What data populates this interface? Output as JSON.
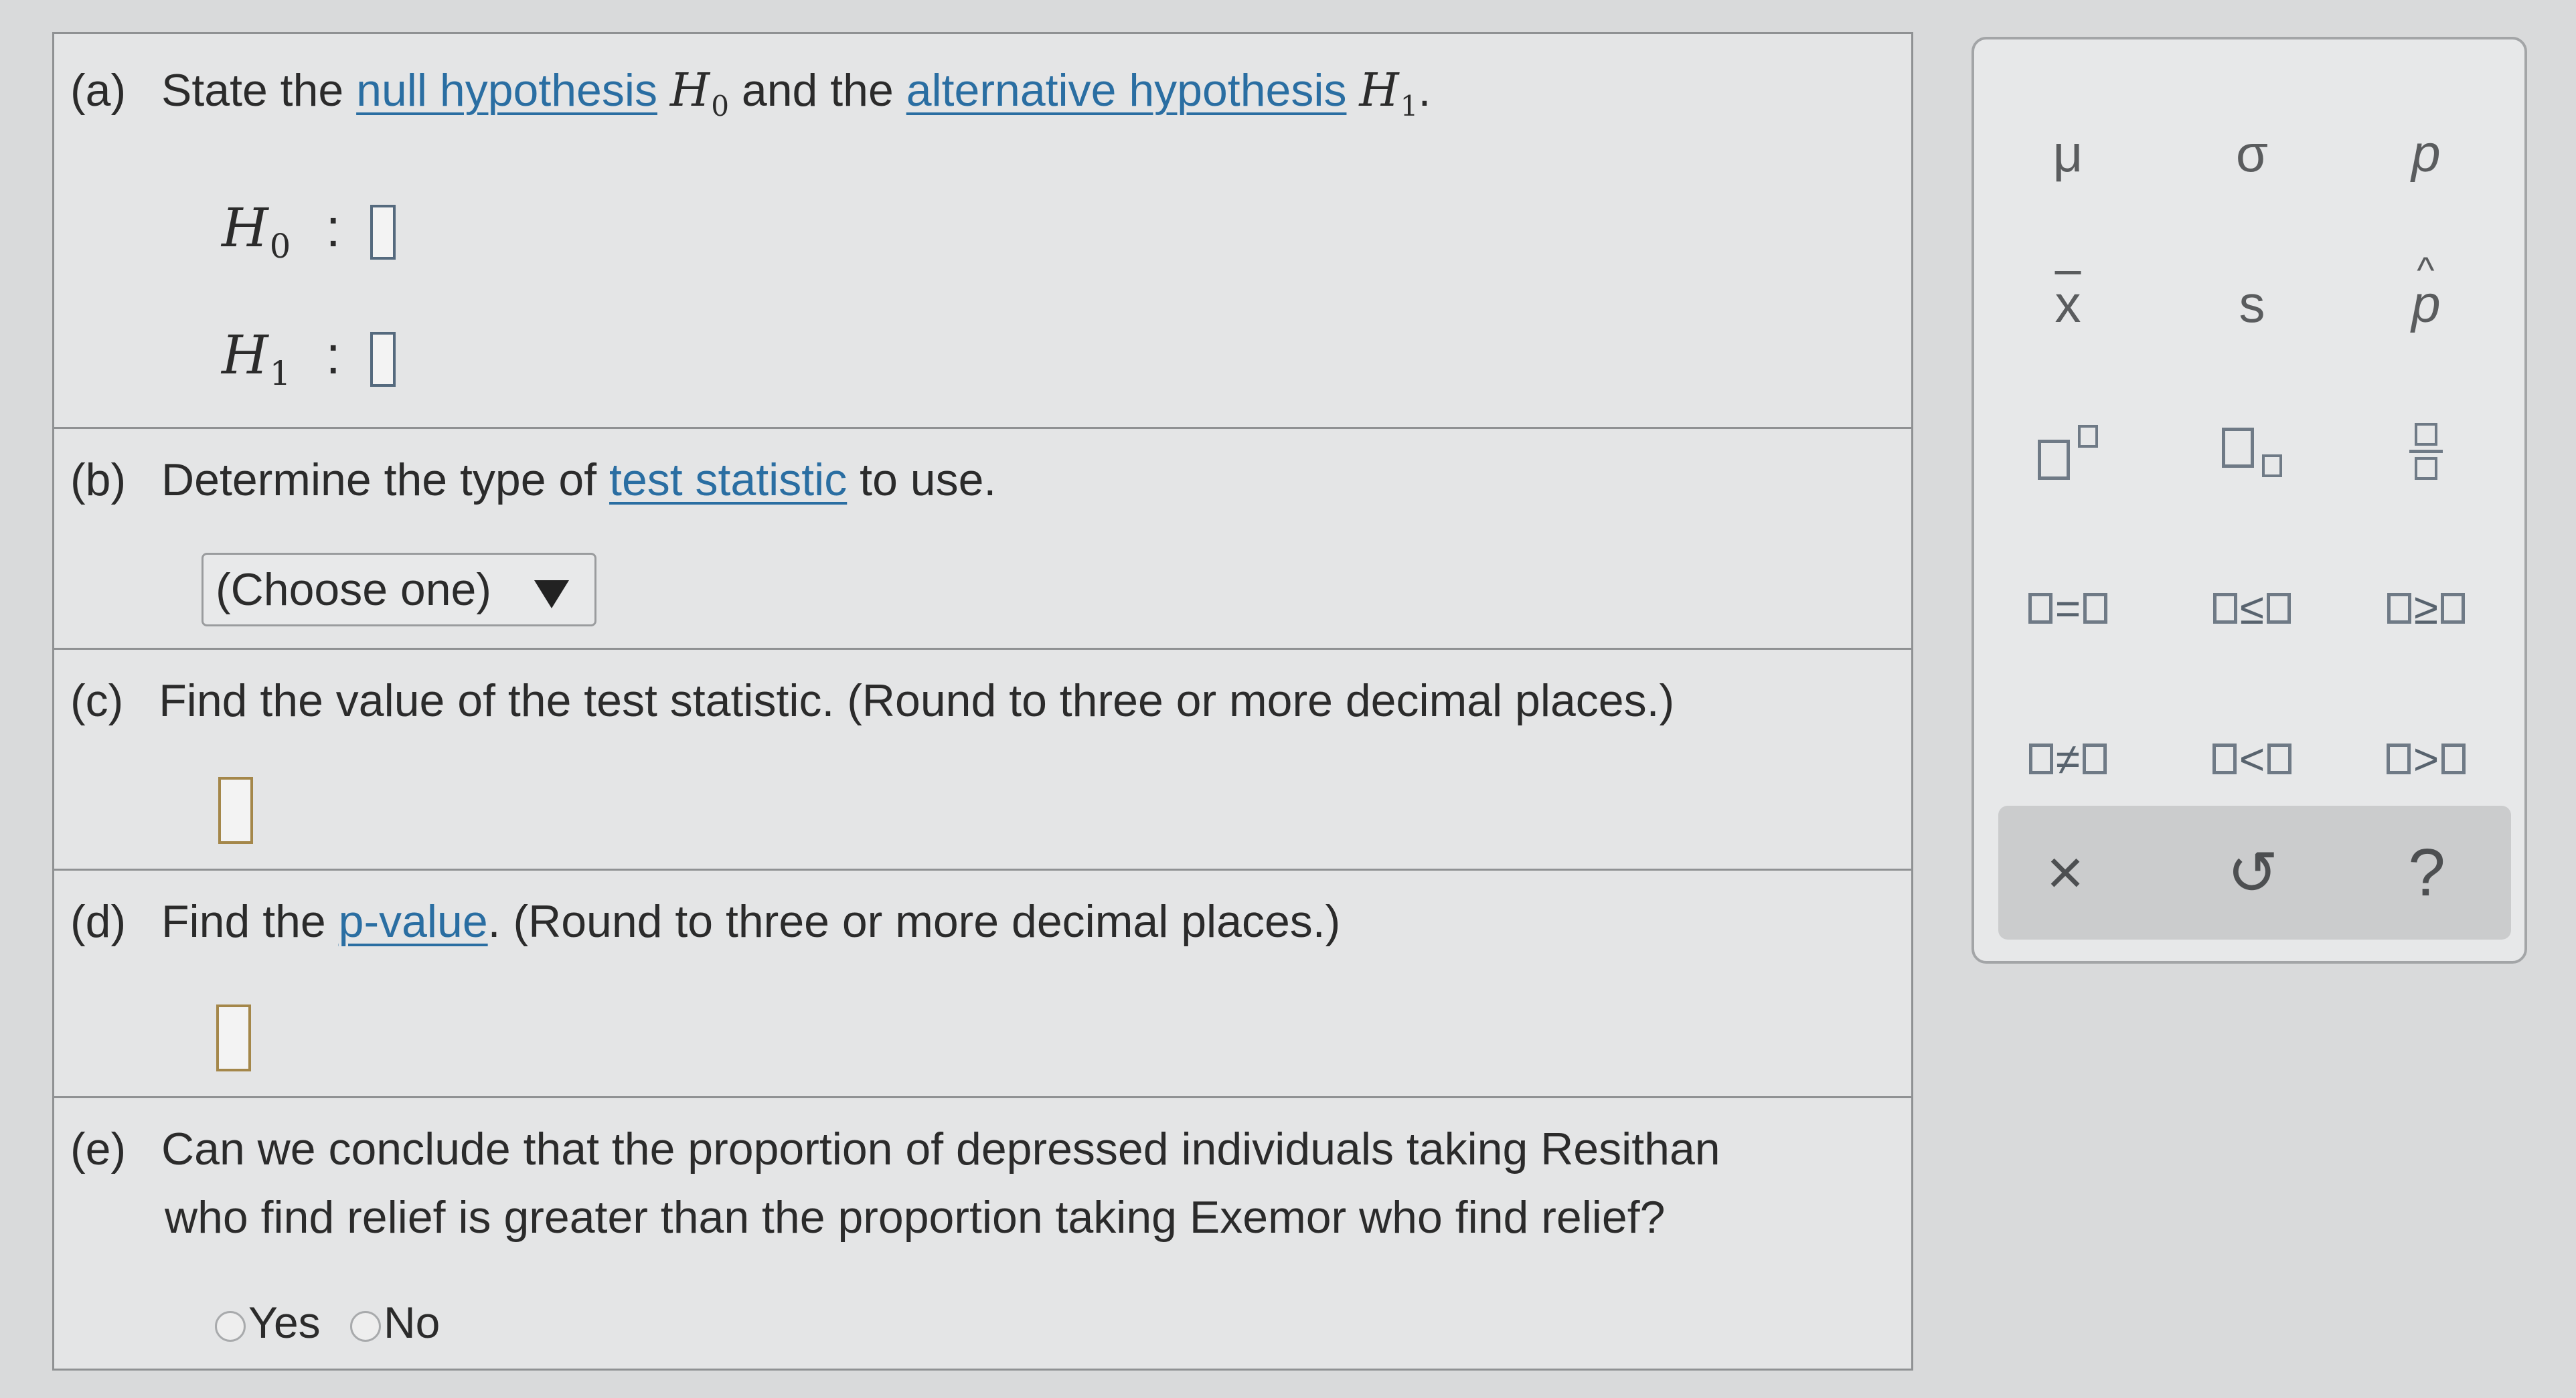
{
  "question_a": {
    "label": "(a)",
    "text_1": "State the",
    "null_link": "null hypothesis",
    "h0": "H",
    "h0_sub": "0",
    "text_2": "and the",
    "alt_link": "alternative hypothesis",
    "h1": "H",
    "h1_sub": "1",
    "period": ".",
    "row_h0_symbol": "H",
    "row_h0_sub": "0",
    "row_h1_symbol": "H",
    "row_h1_sub": "1",
    "colon": ":"
  },
  "question_b": {
    "label": "(b)",
    "text_1": "Determine the type of",
    "link": "test statistic",
    "text_2": "to use.",
    "dropdown_value": "(Choose one)"
  },
  "question_c": {
    "label": "(c)",
    "text": "Find the value of the test statistic. (Round to three or more decimal places.)"
  },
  "question_d": {
    "label": "(d)",
    "text_1": "Find the",
    "link": "p-value",
    "text_2": ". (Round to three or more decimal places.)"
  },
  "question_e": {
    "label": "(e)",
    "line_1": "Can we conclude that the proportion of depressed individuals taking Resithan",
    "line_2": "who find relief is greater than the proportion taking Exemor who find relief?",
    "options": [
      "Yes",
      "No"
    ]
  },
  "palette": {
    "symbols": {
      "mu": "μ",
      "sigma": "σ",
      "p": "p",
      "xbar": "x",
      "s": "s",
      "phat": "p"
    },
    "relations": {
      "eq": "=",
      "le": "≤",
      "ge": "≥",
      "ne": "≠",
      "lt": "<",
      "gt": ">"
    },
    "actions": {
      "clear": "×",
      "undo": "↺",
      "help": "?"
    }
  },
  "colors": {
    "link": "#2a6ea2",
    "answer_box_border": "#556a7e",
    "answer_box_gold": "#a4874a"
  }
}
